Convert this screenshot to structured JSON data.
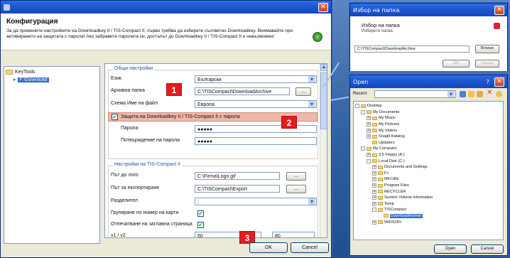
{
  "main": {
    "title": "",
    "header": {
      "heading": "Конфигурация",
      "description": "За да промените настройките на Downloadkey II / TIS-Compact II, първо трябва да изберете съответно Downloadkey. Внимавайте при активирането на защитата с парола! Ако забравите паролата си, достъпът до Downloadkey II / TIS-Compact II е невъзможен!"
    },
    "tree": {
      "root": "KeyTools",
      "child": "F:\\Download"
    },
    "general": {
      "title": "Общи настройки",
      "language_label": "Език",
      "language_value": "Български",
      "archive_label": "Архивна папка",
      "archive_value": "C:\\TISCompact\\DownloadArchive",
      "filename_label": "Схема Име на файл",
      "filename_value": "Европа",
      "password_protect_label": "Защита на Downloadkey II / TIS-Compact II с парола",
      "password_label": "Парола",
      "password_value": "●●●●●",
      "confirm_label": "Потвърждение на парола",
      "confirm_value": "●●●●●"
    },
    "tis": {
      "title": "Настройки на TIS-Compact II",
      "logo_label": "Път до лого",
      "logo_value": "C:\\Firma\\Logo.gif",
      "export_label": "Път за експортиране",
      "export_value": "C:\\TISCompact\\Export",
      "separator_label": "Разделител",
      "separator_value": ";",
      "group_label": "Групиране по номер на карти",
      "print_label": "Отпечатване на заглавна страница",
      "v1v2_label": "v1 / v2",
      "v1_value": "60",
      "v2_value": "80"
    },
    "dots": "...",
    "ok": "OK",
    "cancel": "Cancel",
    "badges": [
      "1",
      "2",
      "3"
    ]
  },
  "picker": {
    "title": "Избор на папка",
    "heading": "Избор на папка",
    "sub": "Изберете папка",
    "path_value": "C:\\TISCompact\\DownloadArchive",
    "browse": "Browse",
    "ok": "OK",
    "cancel": "Cancel"
  },
  "open": {
    "title": "Open",
    "recent_label": "Recent:",
    "items": [
      {
        "label": "Desktop",
        "level": 0,
        "exp": "-"
      },
      {
        "label": "My Documents",
        "level": 1,
        "exp": "-"
      },
      {
        "label": "My Music",
        "level": 2,
        "exp": "+"
      },
      {
        "label": "My Pictures",
        "level": 2,
        "exp": "+"
      },
      {
        "label": "My Videos",
        "level": 2,
        "exp": "+"
      },
      {
        "label": "SnagIt Katalog",
        "level": 2,
        "exp": "+"
      },
      {
        "label": "Updaters",
        "level": 2,
        "exp": ""
      },
      {
        "label": "My Computer",
        "level": 1,
        "exp": "-"
      },
      {
        "label": "3.5 Floppy (A:)",
        "level": 2,
        "exp": "+"
      },
      {
        "label": "Local Disk (C:)",
        "level": 2,
        "exp": "-"
      },
      {
        "label": "Documents and Settings",
        "level": 3,
        "exp": "+"
      },
      {
        "label": "F+",
        "level": 3,
        "exp": "+"
      },
      {
        "label": "MFCdlls",
        "level": 3,
        "exp": "+"
      },
      {
        "label": "Program Files",
        "level": 3,
        "exp": "+"
      },
      {
        "label": "RECYCLER",
        "level": 3,
        "exp": "+"
      },
      {
        "label": "System Volume Information",
        "level": 3,
        "exp": "+"
      },
      {
        "label": "Temp",
        "level": 3,
        "exp": "+"
      },
      {
        "label": "TISCompact",
        "level": 3,
        "exp": "-"
      },
      {
        "label": "DownloadArchive",
        "level": 4,
        "exp": "",
        "selected": true
      },
      {
        "label": "WIDSOFt",
        "level": 3,
        "exp": "+"
      }
    ],
    "open_btn": "Open",
    "cancel_btn": "Cancel"
  },
  "colors": {
    "accent_blue": "#316ac5",
    "badge_red": "#e31d1d",
    "highlight_row": "#eeb8aa"
  }
}
